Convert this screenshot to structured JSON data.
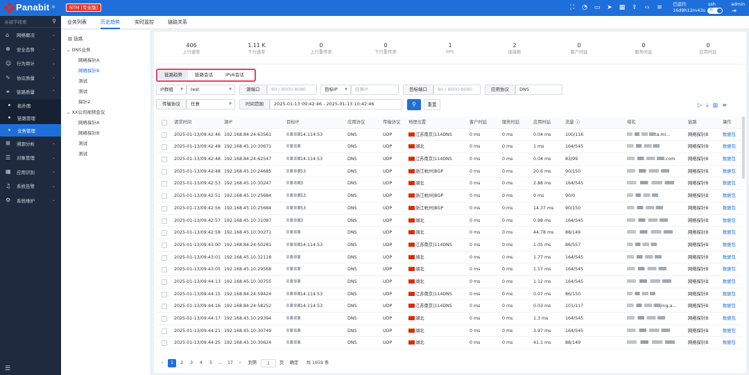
{
  "app": {
    "brand": "Panabit",
    "edition_badge": "NTM [专业版]",
    "uptime_label": "已运行",
    "uptime_value": "16d9h12m43s",
    "user_ssh": "ssh",
    "toggle_label": "开",
    "user_admin": "admin"
  },
  "sidebar": {
    "search_placeholder": "关键字搜索",
    "items": [
      {
        "label": "网络概况",
        "icon": "home-icon"
      },
      {
        "label": "安全态势",
        "icon": "globe-icon"
      },
      {
        "label": "行为审计",
        "icon": "user-icon"
      },
      {
        "label": "协议质量",
        "icon": "pulse-icon"
      },
      {
        "label": "链路质量",
        "icon": "link-icon"
      }
    ],
    "subitems": [
      {
        "label": "拓扑图"
      },
      {
        "label": "链路管理"
      },
      {
        "label": "业务管理"
      }
    ],
    "items2": [
      {
        "label": "溯源分析",
        "icon": "trace-icon"
      },
      {
        "label": "对象管理",
        "icon": "list-icon"
      },
      {
        "label": "应用识别",
        "icon": "grid-icon"
      },
      {
        "label": "系统告警",
        "icon": "bell-icon"
      },
      {
        "label": "系统维护",
        "icon": "gear-icon"
      }
    ]
  },
  "tabs": [
    "业务列表",
    "历史趋势",
    "实时监控",
    "链路关系"
  ],
  "tree": {
    "root": "链路",
    "groups": [
      {
        "label": "DNS业务",
        "children": [
          "网络探针A",
          "网络探针B",
          "测试",
          "测试",
          "探针2"
        ]
      },
      {
        "label": "XX公司视频会议",
        "children": [
          "网络探针A",
          "网络探针B",
          "测试",
          "测试"
        ]
      }
    ]
  },
  "stats": [
    {
      "value": "406",
      "label": "上行速率"
    },
    {
      "value": "1.11 K",
      "label": "下行速率"
    },
    {
      "value": "0",
      "label": "上行重传率"
    },
    {
      "value": "0",
      "label": "下行重传率"
    },
    {
      "value": "1",
      "label": "PPS"
    },
    {
      "value": "2",
      "label": "连接数"
    },
    {
      "value": "0",
      "label": "客户时延"
    },
    {
      "value": "0",
      "label": "服务时延"
    },
    {
      "value": "0",
      "label": "应用时延"
    }
  ],
  "subtabs": [
    "链路趋势",
    "链路会话",
    "IPv6会话"
  ],
  "filters": {
    "ip_type": "IP群组",
    "ip_value": "test",
    "src_port_label": "源端口",
    "src_port_ph": "80 / 8000-8080",
    "dst_ip_label": "目标IP",
    "dst_ip_ph": "任意IP",
    "dst_port_label": "目标端口",
    "dst_port_ph": "80 / 8000-8080",
    "app_label": "应用协议",
    "app_value": "DNS",
    "trans_label": "传输协议",
    "trans_value": "任意",
    "time_label": "时间范围",
    "time_value": "2025-01-13 09:42:46 - 2025-01-13 10:42:46",
    "reset": "重置"
  },
  "table": {
    "headers": [
      "请求时间",
      "源IP",
      "目标IP",
      "应用协议",
      "传输协议",
      "地理位置",
      "客户时延",
      "服务时延",
      "应用时延",
      "流量",
      "域名",
      "链路",
      "操作"
    ],
    "rows": [
      {
        "time": "2025-01-13/09:42:46",
        "src": "192.168.84.24:63561",
        "dst": "14.114:53",
        "app": "DNS",
        "trans": "UDP",
        "geo": "江苏南京|114DNS",
        "c": "0 ms",
        "s": "0 ms",
        "a": "0.04 ms",
        "flow": "100/116",
        "domain": "ta.mi...",
        "link": "网络探针B",
        "op": "数据包"
      },
      {
        "time": "2025-01-13/09:42:48",
        "src": "192.168.45.10:30671",
        "dst": "",
        "app": "DNS",
        "trans": "UDP",
        "geo": "湖北",
        "c": "0 ms",
        "s": "0 ms",
        "a": "1 ms",
        "flow": "164/545",
        "domain": "",
        "link": "网络探针B",
        "op": "数据包"
      },
      {
        "time": "2025-01-13/09:42:48",
        "src": "192.168.84.24:62547",
        "dst": "14.114:53",
        "app": "DNS",
        "trans": "UDP",
        "geo": "江苏南京|114DNS",
        "c": "0 ms",
        "s": "0 ms",
        "a": "0.04 ms",
        "flow": "83/99",
        "domain": ".com",
        "link": "网络探针B",
        "op": "数据包"
      },
      {
        "time": "2025-01-13/09:42:48",
        "src": "192.168.45.10:24685",
        "dst": "53",
        "app": "DNS",
        "trans": "UDP",
        "geo": "浙江杭州|BGP",
        "c": "0 ms",
        "s": "0 ms",
        "a": "20.6 ms",
        "flow": "90/150",
        "domain": "",
        "link": "网络探针B",
        "op": "数据包"
      },
      {
        "time": "2025-01-13/09:42:53",
        "src": "192.168.45.10:30247",
        "dst": "3",
        "app": "DNS",
        "trans": "UDP",
        "geo": "湖北",
        "c": "0 ms",
        "s": "0 ms",
        "a": "2.88 ms",
        "flow": "164/545",
        "domain": "",
        "link": "网络探针B",
        "op": "数据包"
      },
      {
        "time": "2025-01-13/09:42:51",
        "src": "192.168.45.10:25684",
        "dst": "53",
        "app": "DNS",
        "trans": "UDP",
        "geo": "浙江杭州|BGP",
        "c": "0 ms",
        "s": "0 ms",
        "a": "0 ms",
        "flow": "90/0",
        "domain": "",
        "link": "网络探针B",
        "op": "数据包"
      },
      {
        "time": "2025-01-13/09:42:56",
        "src": "192.168.45.10:25684",
        "dst": "53",
        "app": "DNS",
        "trans": "UDP",
        "geo": "浙江杭州|BGP",
        "c": "0 ms",
        "s": "0 ms",
        "a": "14.37 ms",
        "flow": "90/150",
        "domain": "",
        "link": "网络探针B",
        "op": "数据包"
      },
      {
        "time": "2025-01-13/09:42:57",
        "src": "192.168.45.10:31087",
        "dst": "3",
        "app": "DNS",
        "trans": "UDP",
        "geo": "湖北",
        "c": "0 ms",
        "s": "0 ms",
        "a": "0.98 ms",
        "flow": "164/545",
        "domain": "",
        "link": "网络探针B",
        "op": "数据包"
      },
      {
        "time": "2025-01-13/09:42:58",
        "src": "192.168.45.10:30271",
        "dst": "",
        "app": "DNS",
        "trans": "UDP",
        "geo": "湖北",
        "c": "0 ms",
        "s": "0 ms",
        "a": "44.78 ms",
        "flow": "88/149",
        "domain": "",
        "link": "网络探针B",
        "op": "数据包"
      },
      {
        "time": "2025-01-13/09:43:00",
        "src": "192.168.84.24:50281",
        "dst": "14.114:53",
        "app": "DNS",
        "trans": "UDP",
        "geo": "江苏南京|114DNS",
        "c": "0 ms",
        "s": "0 ms",
        "a": "1.05 ms",
        "flow": "86/557",
        "domain": "",
        "link": "网络探针B",
        "op": "数据包"
      },
      {
        "time": "2025-01-13/09:43:01",
        "src": "192.168.45.10:32118",
        "dst": "",
        "app": "DNS",
        "trans": "UDP",
        "geo": "湖北",
        "c": "0 ms",
        "s": "0 ms",
        "a": "1.77 ms",
        "flow": "164/545",
        "domain": "",
        "link": "网络探针B",
        "op": "数据包"
      },
      {
        "time": "2025-01-13/09:43:05",
        "src": "192.168.45.10:29568",
        "dst": "",
        "app": "DNS",
        "trans": "UDP",
        "geo": "湖北",
        "c": "0 ms",
        "s": "0 ms",
        "a": "1.17 ms",
        "flow": "164/545",
        "domain": "",
        "link": "网络探针B",
        "op": "数据包"
      },
      {
        "time": "2025-01-13/09:44:13",
        "src": "192.168.45.10:30755",
        "dst": "",
        "app": "DNS",
        "trans": "UDP",
        "geo": "湖北",
        "c": "0 ms",
        "s": "0 ms",
        "a": "1.12 ms",
        "flow": "164/545",
        "domain": "",
        "link": "网络探针B",
        "op": "数据包"
      },
      {
        "time": "2025-01-13/09:44:15",
        "src": "192.168.84.24:59424",
        "dst": "14.114:53",
        "app": "DNS",
        "trans": "UDP",
        "geo": "江苏南京|114DNS",
        "c": "0 ms",
        "s": "0 ms",
        "a": "0.07 ms",
        "flow": "86/150",
        "domain": "",
        "link": "网络探针B",
        "op": "数据包"
      },
      {
        "time": "2025-01-13/09:44:16",
        "src": "192.168.84.24:58252",
        "dst": "14.114:53",
        "app": "DNS",
        "trans": "UDP",
        "geo": "江苏南京|114DNS",
        "c": "0 ms",
        "s": "0 ms",
        "a": "0.03 ms",
        "flow": "101/117",
        "domain": "jing.a...",
        "link": "网络探针B",
        "op": "数据包"
      },
      {
        "time": "2025-01-13/09:44:17",
        "src": "192.168.45.10:29394",
        "dst": "",
        "app": "DNS",
        "trans": "UDP",
        "geo": "湖北",
        "c": "0 ms",
        "s": "0 ms",
        "a": "1.3 ms",
        "flow": "164/545",
        "domain": "",
        "link": "网络探针B",
        "op": "数据包"
      },
      {
        "time": "2025-01-13/09:44:21",
        "src": "192.168.45.10:30749",
        "dst": "",
        "app": "DNS",
        "trans": "UDP",
        "geo": "湖北",
        "c": "0 ms",
        "s": "0 ms",
        "a": "3.97 ms",
        "flow": "164/545",
        "domain": "",
        "link": "网络探针B",
        "op": "数据包"
      },
      {
        "time": "2025-01-13/09:44:25",
        "src": "192.168.45.10:30624",
        "dst": "",
        "app": "DNS",
        "trans": "UDP",
        "geo": "湖北",
        "c": "0 ms",
        "s": "0 ms",
        "a": "41.1 ms",
        "flow": "88/149",
        "domain": "",
        "link": "网络探针B",
        "op": "数据包"
      }
    ]
  },
  "pager": {
    "pages": [
      "1",
      "2",
      "3",
      "4",
      "5",
      "...",
      "17"
    ],
    "goto": "到第",
    "goto_value": "1",
    "page_unit": "页",
    "confirm": "确定",
    "total": "共 1659 条"
  }
}
